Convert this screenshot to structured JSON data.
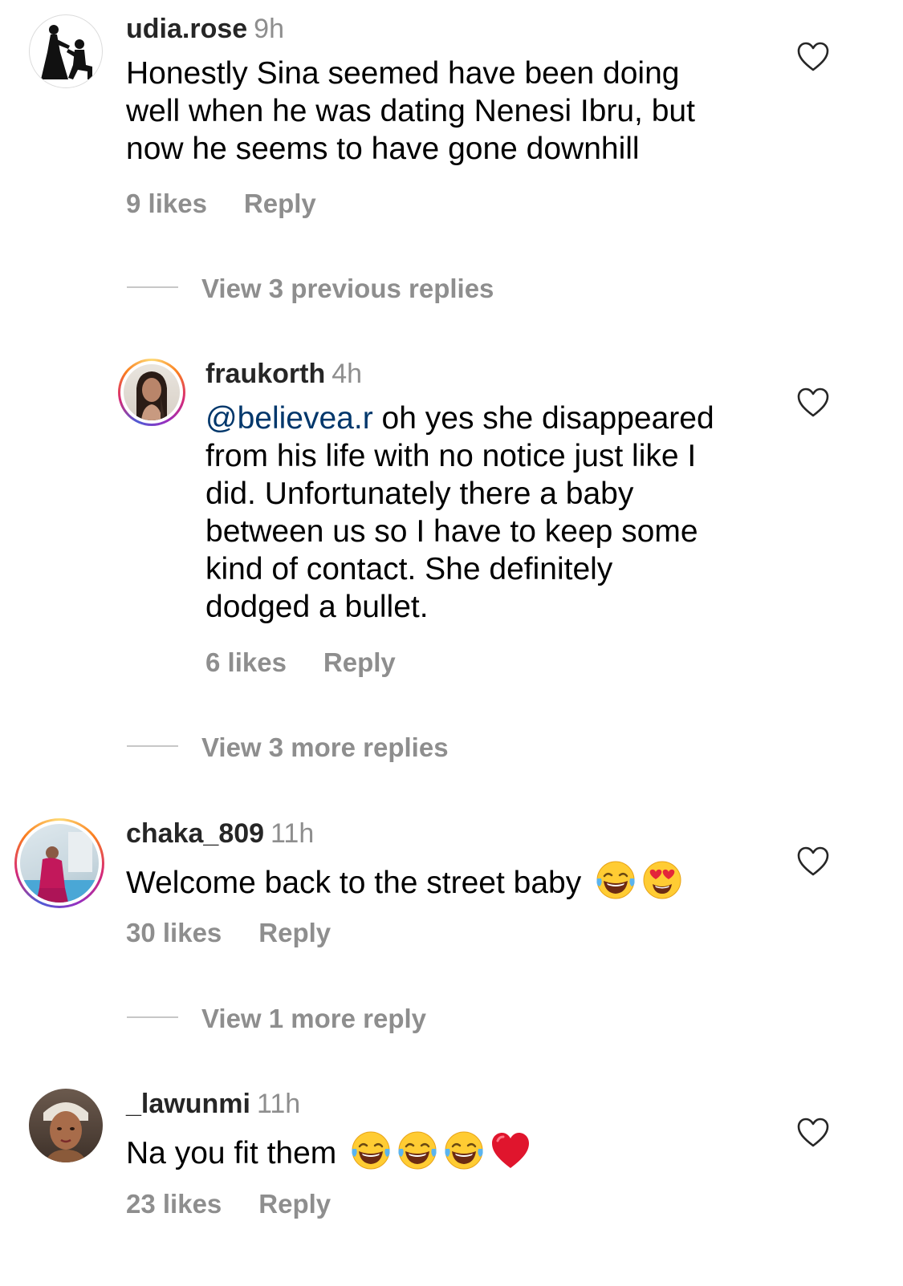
{
  "comments": [
    {
      "username": "udia.rose",
      "time": "9h",
      "lines": [
        "Honestly Sina seemed have been doing",
        "well when he was dating Nenesi Ibru, but",
        "now he seems to have gone downhill"
      ],
      "likes": "9 likes",
      "reply": "Reply",
      "avatar": "silhouette-proposal"
    },
    {
      "username": "fraukorth",
      "time": "4h",
      "mention": "@believea.r",
      "lines": [
        " oh yes she disappeared",
        "from his life with no notice just like I",
        "did. Unfortunately there a baby",
        "between us so I have to keep some",
        "kind of contact. She definitely",
        "dodged a bullet."
      ],
      "likes": "6 likes",
      "reply": "Reply",
      "avatar": "photo-woman-braids"
    },
    {
      "username": "chaka_809",
      "time": "11h",
      "text": "Welcome back to the street baby",
      "emojis": [
        "tears-of-joy",
        "heart-eyes"
      ],
      "likes": "30 likes",
      "reply": "Reply",
      "avatar": "photo-woman-pink"
    },
    {
      "username": "_lawunmi",
      "time": "11h",
      "text": "Na you fit them",
      "emojis": [
        "tears-of-joy",
        "tears-of-joy",
        "tears-of-joy",
        "red-heart"
      ],
      "likes": "23 likes",
      "reply": "Reply",
      "avatar": "photo-woman-closeup"
    }
  ],
  "view_more": {
    "previous_3": "View 3 previous replies",
    "more_3": "View 3 more replies",
    "more_1": "View 1 more reply"
  },
  "icons": {
    "like": "heart-outline-icon"
  },
  "colors": {
    "text": "#000000",
    "username": "#262626",
    "secondary": "#8e8e8e",
    "mention": "#00376b",
    "divider": "#c7c7c7"
  }
}
